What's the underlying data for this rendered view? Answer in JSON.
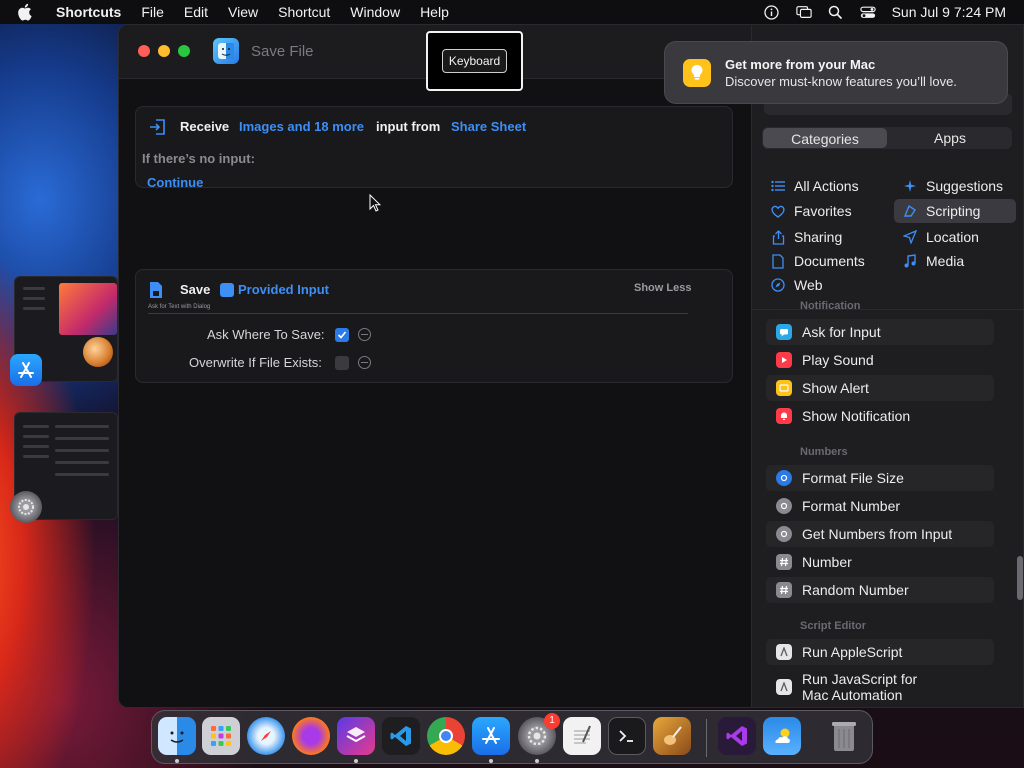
{
  "menubar": {
    "app_name": "Shortcuts",
    "items": [
      "File",
      "Edit",
      "View",
      "Shortcut",
      "Window",
      "Help"
    ],
    "clock": "Sun Jul 9  7:24 PM"
  },
  "window": {
    "title": "Save File"
  },
  "keyboard_tooltip": "Keyboard",
  "receive_card": {
    "label": "Receive",
    "input_types": "Images and 18 more",
    "input_from_label": "input from",
    "source": "Share Sheet",
    "no_input_label": "If there’s no input:",
    "no_input_action": "Continue"
  },
  "save_card": {
    "label": "Save",
    "variable": "Provided Input",
    "toggle_label": "Show Less",
    "strip_text": "Ask for Text with Dialog",
    "ask_where_label": "Ask Where To Save:",
    "ask_where_checked": true,
    "overwrite_label": "Overwrite If File Exists:",
    "overwrite_checked": false
  },
  "notification": {
    "title": "Get more from your Mac",
    "body": "Discover must-know features you’ll love."
  },
  "sidebar": {
    "segments": [
      "Categories",
      "Apps"
    ],
    "selected_segment": "Categories",
    "categories": [
      {
        "label": "All Actions",
        "icon": "list-icon"
      },
      {
        "label": "Suggestions",
        "icon": "sparkle-icon"
      },
      {
        "label": "Favorites",
        "icon": "heart-icon"
      },
      {
        "label": "Scripting",
        "icon": "scripting-icon"
      },
      {
        "label": "Sharing",
        "icon": "share-icon"
      },
      {
        "label": "Location",
        "icon": "location-arrow-icon"
      },
      {
        "label": "Documents",
        "icon": "document-icon"
      },
      {
        "label": "Media",
        "icon": "music-note-icon"
      },
      {
        "label": "Web",
        "icon": "compass-icon"
      }
    ],
    "selected_category": "Scripting",
    "section_notification": "Notification",
    "notification_actions": [
      "Ask for Input",
      "Play Sound",
      "Show Alert",
      "Show Notification"
    ],
    "section_numbers": "Numbers",
    "number_actions": [
      "Format File Size",
      "Format Number",
      "Get Numbers from Input",
      "Number",
      "Random Number"
    ],
    "section_script_editor": "Script Editor",
    "script_actions": [
      "Run AppleScript",
      "Run JavaScript for",
      "Mac Automation"
    ]
  },
  "dock": {
    "apps": [
      "Finder",
      "Launchpad",
      "Safari",
      "Firefox",
      "Shortcuts",
      "Visual Studio Code",
      "Google Chrome",
      "App Store",
      "System Settings",
      "TextEdit",
      "Terminal",
      "Instruments",
      "Visual Studio",
      "Weather",
      "Trash"
    ],
    "settings_badge": "1"
  },
  "colors": {
    "accent": "#3d8ef5",
    "notif_icon": "#ffc21a"
  }
}
